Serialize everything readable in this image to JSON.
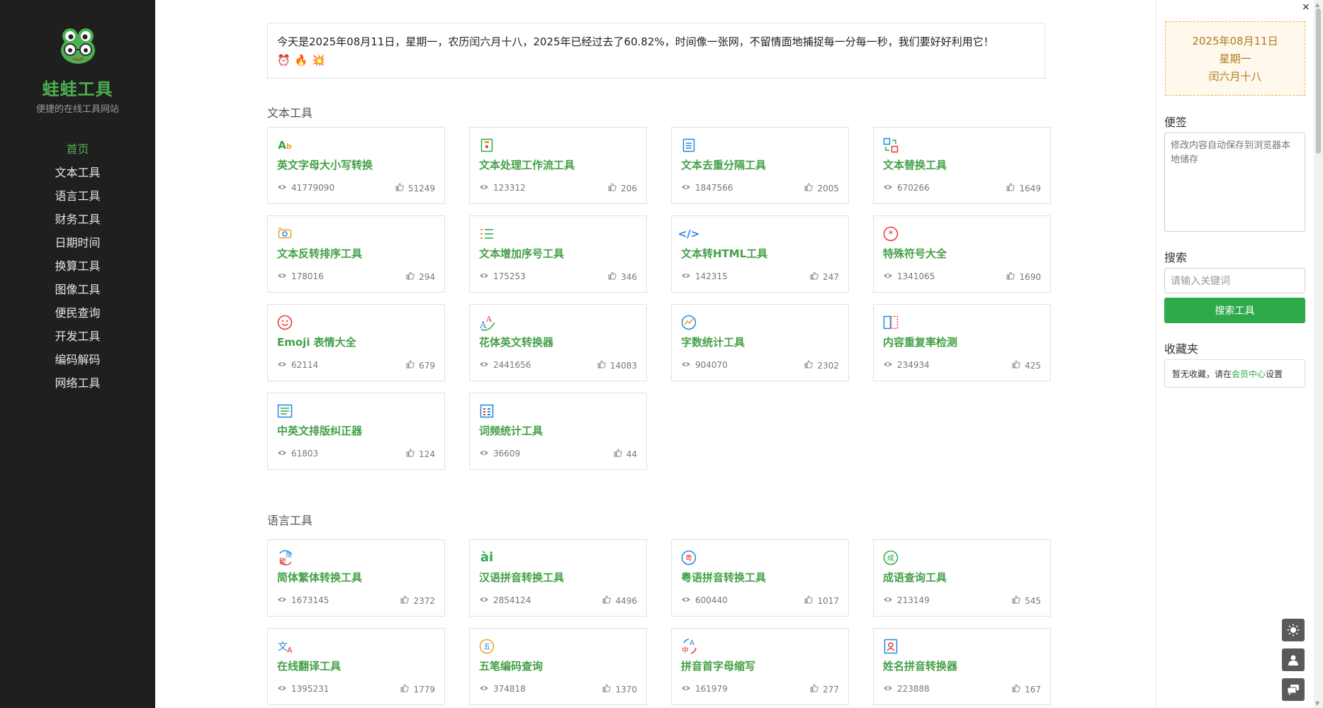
{
  "sidebar": {
    "brand": "蛙蛙工具",
    "slogan": "便捷的在线工具网站",
    "nav": [
      "首页",
      "文本工具",
      "语言工具",
      "财务工具",
      "日期时间",
      "换算工具",
      "图像工具",
      "便民查询",
      "开发工具",
      "编码解码",
      "网络工具"
    ]
  },
  "notice": {
    "text": "今天是2025年08月11日，星期一，农历闰六月十八，2025年已经过去了60.82%，时间像一张网，不留情面地捕捉每一分每一秒，我们要好好利用它！",
    "emojis": [
      "⏰",
      "🔥",
      "💥"
    ]
  },
  "sections": [
    {
      "title": "文本工具",
      "tools": [
        {
          "name": "英文字母大小写转换",
          "views": "41779090",
          "likes": "51249"
        },
        {
          "name": "文本处理工作流工具",
          "views": "123312",
          "likes": "206"
        },
        {
          "name": "文本去重分隔工具",
          "views": "1847566",
          "likes": "2005"
        },
        {
          "name": "文本替换工具",
          "views": "670266",
          "likes": "1649"
        },
        {
          "name": "文本反转排序工具",
          "views": "178016",
          "likes": "294"
        },
        {
          "name": "文本增加序号工具",
          "views": "175253",
          "likes": "346"
        },
        {
          "name": "文本转HTML工具",
          "views": "142315",
          "likes": "247"
        },
        {
          "name": "特殊符号大全",
          "views": "1341065",
          "likes": "1690"
        },
        {
          "name": "Emoji 表情大全",
          "views": "62114",
          "likes": "679"
        },
        {
          "name": "花体英文转换器",
          "views": "2441656",
          "likes": "14083"
        },
        {
          "name": "字数统计工具",
          "views": "904070",
          "likes": "2302"
        },
        {
          "name": "内容重复率检测",
          "views": "234934",
          "likes": "425"
        },
        {
          "name": "中英文排版纠正器",
          "views": "61803",
          "likes": "124"
        },
        {
          "name": "词频统计工具",
          "views": "36609",
          "likes": "44"
        }
      ]
    },
    {
      "title": "语言工具",
      "tools": [
        {
          "name": "简体繁体转换工具",
          "views": "1673145",
          "likes": "2372"
        },
        {
          "name": "汉语拼音转换工具",
          "views": "2854124",
          "likes": "4496"
        },
        {
          "name": "粤语拼音转换工具",
          "views": "600440",
          "likes": "1017"
        },
        {
          "name": "成语查询工具",
          "views": "213149",
          "likes": "545"
        },
        {
          "name": "在线翻译工具",
          "views": "1395231",
          "likes": "1779"
        },
        {
          "name": "五笔编码查询",
          "views": "374818",
          "likes": "1370"
        },
        {
          "name": "拼音首字母缩写",
          "views": "161979",
          "likes": "277"
        },
        {
          "name": "姓名拼音转换器",
          "views": "223888",
          "likes": "167"
        }
      ]
    }
  ],
  "icon_glyphs": {
    "s1": [
      "Ab",
      "",
      "",
      "",
      "",
      "",
      "",
      "",
      "",
      "",
      "",
      "",
      "",
      ""
    ],
    "s2": [
      "繁",
      "ài",
      "粤",
      "成",
      "文",
      "五",
      "A",
      ""
    ]
  },
  "right": {
    "date": [
      "2025年08月11日",
      "星期一",
      "闰六月十八"
    ],
    "memo_title": "便签",
    "memo_placeholder": "修改内容自动保存到浏览器本地储存",
    "search_title": "搜索",
    "search_placeholder": "请输入关键词",
    "search_button": "搜索工具",
    "fav_title": "收藏夹",
    "fav_prefix": "暂无收藏，请在",
    "fav_link": "会员中心",
    "fav_suffix": "设置",
    "close": "×"
  },
  "colors": {
    "sidebar_bg": "#1f1f1f",
    "accent_green": "#43a047",
    "button_green": "#2ea94b",
    "date_text": "#b07a1e"
  }
}
